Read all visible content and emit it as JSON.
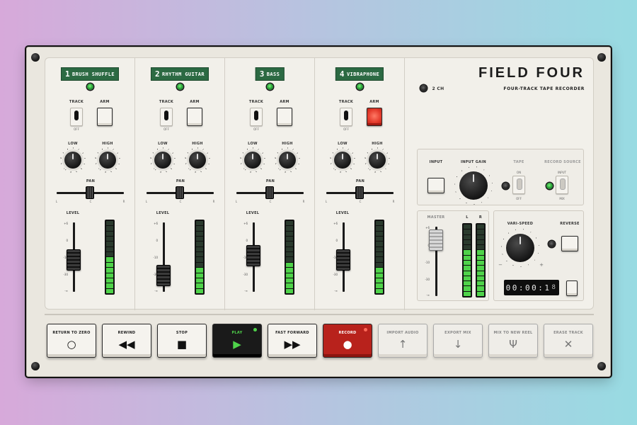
{
  "device": {
    "brand": "FIELD FOUR",
    "subtitle": "FOUR-TRACK TAPE RECORDER",
    "channel_mode": "2 CH"
  },
  "channels": [
    {
      "num": "1",
      "name": "BRUSH SHUFFLE",
      "arm_on": false
    },
    {
      "num": "2",
      "name": "RHYTHM GUITAR",
      "arm_on": false
    },
    {
      "num": "3",
      "name": "BASS",
      "arm_on": false
    },
    {
      "num": "4",
      "name": "VIBRAPHONE",
      "arm_on": true
    }
  ],
  "labels": {
    "track": "TRACK",
    "arm": "ARM",
    "off": "OFF",
    "low": "LOW",
    "high": "HIGH",
    "pan": "PAN",
    "level": "LEVEL",
    "l": "L",
    "c": "C",
    "r": "R"
  },
  "level_scale": [
    "+6",
    "0",
    "-10",
    "-30",
    "-∞"
  ],
  "master_scale": [
    "+6",
    "0",
    "-10",
    "-30",
    "-∞"
  ],
  "meters_lit": [
    7,
    5,
    6,
    5
  ],
  "master_meters_lit": [
    9,
    9
  ],
  "input_section": {
    "input": "INPUT",
    "input_gain": "INPUT GAIN",
    "tape": "TAPE",
    "tape_on": "ON",
    "tape_off": "OFF",
    "record_source": "RECORD SOURCE",
    "src_input": "INPUT",
    "src_mix": "MIX"
  },
  "master_section": {
    "master": "MASTER",
    "l": "L",
    "r": "R"
  },
  "vari_section": {
    "vari_speed": "VARI-SPEED",
    "reverse": "REVERSE",
    "minus": "−",
    "plus": "+"
  },
  "counter": {
    "digits": "00:00:1",
    "last_digit": "8"
  },
  "transport": [
    {
      "label": "RETURN TO ZERO",
      "icon": "○",
      "style": "normal"
    },
    {
      "label": "REWIND",
      "icon": "◀◀",
      "style": "normal"
    },
    {
      "label": "STOP",
      "icon": "■",
      "style": "normal"
    },
    {
      "label": "PLAY",
      "icon": "▶",
      "style": "dark"
    },
    {
      "label": "FAST FORWARD",
      "icon": "▶▶",
      "style": "normal"
    },
    {
      "label": "RECORD",
      "icon": "●",
      "style": "red"
    },
    {
      "label": "IMPORT AUDIO",
      "icon": "↑",
      "style": "muted"
    },
    {
      "label": "EXPORT MIX",
      "icon": "↓",
      "style": "muted"
    },
    {
      "label": "MIX TO NEW REEL",
      "icon": "Ψ",
      "style": "muted"
    },
    {
      "label": "ERASE TRACK",
      "icon": "✕",
      "style": "muted"
    }
  ],
  "colors": {
    "accent_green": "#2c6a43",
    "record_red": "#b8221c",
    "meter_green": "#4fd34a"
  }
}
